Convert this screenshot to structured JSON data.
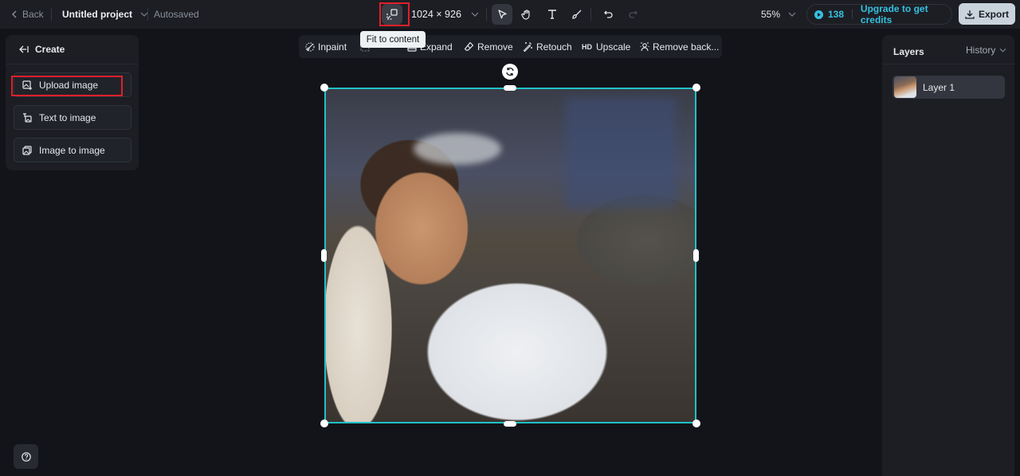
{
  "topbar": {
    "back_label": "Back",
    "project_title": "Untitled project",
    "save_status": "Autosaved",
    "canvas_size": "1024 × 926",
    "zoom_level": "55%",
    "credits_count": "138",
    "upgrade_label": "Upgrade to get credits",
    "export_label": "Export",
    "fit_tooltip": "Fit to content"
  },
  "left_panel": {
    "title": "Create",
    "items": [
      {
        "label": "Upload image",
        "icon": "upload-image-icon"
      },
      {
        "label": "Text to image",
        "icon": "text-to-image-icon"
      },
      {
        "label": "Image to image",
        "icon": "image-to-image-icon"
      }
    ]
  },
  "edit_toolbar": {
    "items": [
      {
        "label": "Inpaint",
        "icon": "inpaint-icon"
      },
      {
        "label": "",
        "icon": "hidden-tool-icon"
      },
      {
        "label": "Expand",
        "icon": "expand-icon"
      },
      {
        "label": "Remove",
        "icon": "eraser-icon"
      },
      {
        "label": "Retouch",
        "icon": "magic-wand-icon"
      },
      {
        "label": "Upscale",
        "icon": "hd-icon",
        "badge": "HD"
      },
      {
        "label": "Remove back...",
        "icon": "remove-background-icon"
      }
    ]
  },
  "right_panel": {
    "title": "Layers",
    "history_label": "History",
    "layers": [
      {
        "name": "Layer 1"
      }
    ]
  },
  "colors": {
    "accent": "#35c2e0",
    "selection": "#1fc2c8",
    "highlight_box": "#e0202a",
    "background": "#131419",
    "panel": "#1c1e24"
  }
}
